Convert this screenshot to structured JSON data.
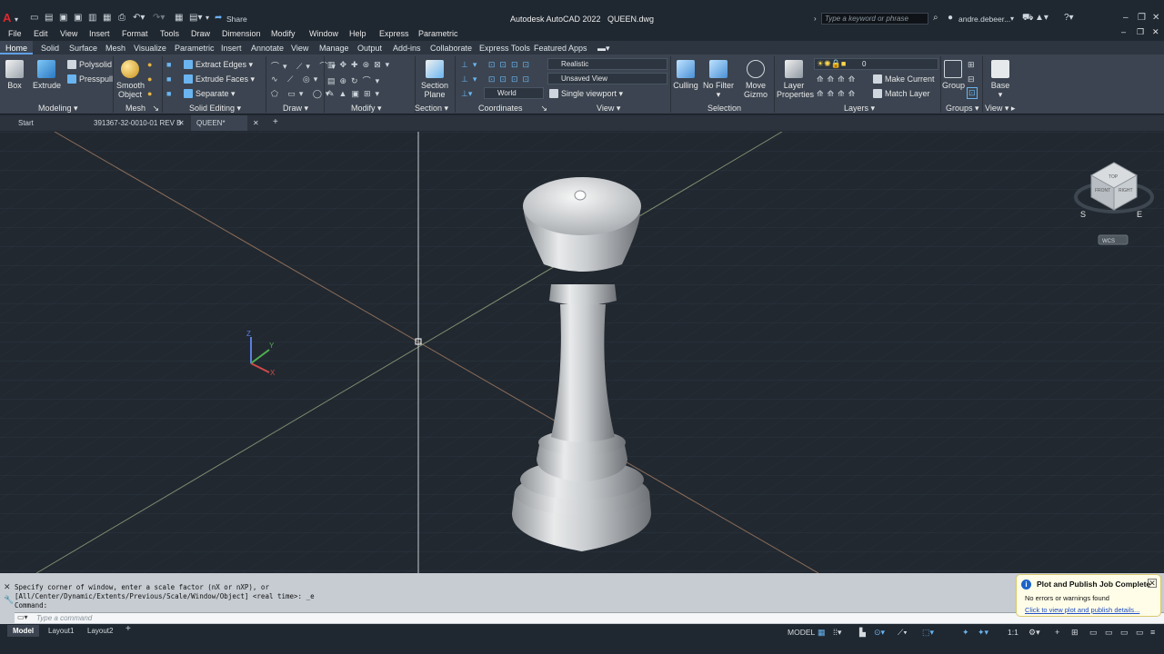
{
  "app": {
    "title": "Autodesk AutoCAD 2022",
    "file": "QUEEN.dwg",
    "logo": "A"
  },
  "qat": {
    "share_label": "Share"
  },
  "search": {
    "placeholder": "Type a keyword or phrase"
  },
  "user": {
    "name": "andre.debeer..."
  },
  "menu": [
    "File",
    "Edit",
    "View",
    "Insert",
    "Format",
    "Tools",
    "Draw",
    "Dimension",
    "Modify",
    "Window",
    "Help",
    "Express",
    "Parametric"
  ],
  "ribbon_tabs": [
    "Home",
    "Solid",
    "Surface",
    "Mesh",
    "Visualize",
    "Parametric",
    "Insert",
    "Annotate",
    "View",
    "Manage",
    "Output",
    "Add-ins",
    "Collaborate",
    "Express Tools",
    "Featured Apps"
  ],
  "ribbon": {
    "modeling": {
      "box": "Box",
      "extrude": "Extrude",
      "polysolid": "Polysolid",
      "presspull": "Presspull",
      "panel": "Modeling"
    },
    "mesh": {
      "smooth_object": "Smooth Object",
      "smooth_object_l1": "Smooth",
      "smooth_object_l2": "Object",
      "panel": "Mesh"
    },
    "solid_editing": {
      "extract_edges": "Extract Edges",
      "extrude_faces": "Extrude Faces",
      "separate": "Separate",
      "panel": "Solid Editing"
    },
    "draw": {
      "panel": "Draw"
    },
    "modify": {
      "panel": "Modify"
    },
    "section": {
      "section_plane_l1": "Section",
      "section_plane_l2": "Plane",
      "panel": "Section"
    },
    "coordinates": {
      "world": "World",
      "panel": "Coordinates"
    },
    "view": {
      "visual_style": "Realistic",
      "named_view": "Unsaved View",
      "viewport": "Single viewport",
      "panel": "View"
    },
    "selection": {
      "culling": "Culling",
      "no_filter": "No Filter",
      "move_gizmo_l1": "Move",
      "move_gizmo_l2": "Gizmo",
      "panel": "Selection"
    },
    "layers": {
      "layer_props_l1": "Layer",
      "layer_props_l2": "Properties",
      "current_layer": "0",
      "make_current": "Make Current",
      "match_layer": "Match Layer",
      "panel": "Layers"
    },
    "groups": {
      "group": "Group",
      "panel": "Groups"
    },
    "view2": {
      "base": "Base",
      "panel": "View"
    }
  },
  "doc_tabs": [
    {
      "label": "Start"
    },
    {
      "label": "391367-32-0010-01 REV B"
    },
    {
      "label": "QUEEN*"
    }
  ],
  "viewcube": {
    "top": "TOP",
    "front": "FRONT",
    "right": "RIGHT",
    "s": "S",
    "e": "E",
    "wcs": "WCS"
  },
  "ucs": {
    "x": "X",
    "y": "Y",
    "z": "Z"
  },
  "command": {
    "history": [
      "Specify corner of window, enter a scale factor (nX or nXP), or",
      "[All/Center/Dynamic/Extents/Previous/Scale/Window/Object] <real time>: _e",
      "Command:"
    ],
    "placeholder": "Type a command"
  },
  "layout_tabs": [
    "Model",
    "Layout1",
    "Layout2"
  ],
  "status": {
    "model": "MODEL",
    "scale": "1:1"
  },
  "notification": {
    "title": "Plot and Publish Job Complete",
    "message": "No errors or warnings found",
    "link": "Click to view plot and publish details..."
  },
  "colors": {
    "viewport_bg": "#212830",
    "ribbon_bg": "#3b4450",
    "accent": "#5fa0e6",
    "notify_bg": "#fffde8"
  }
}
